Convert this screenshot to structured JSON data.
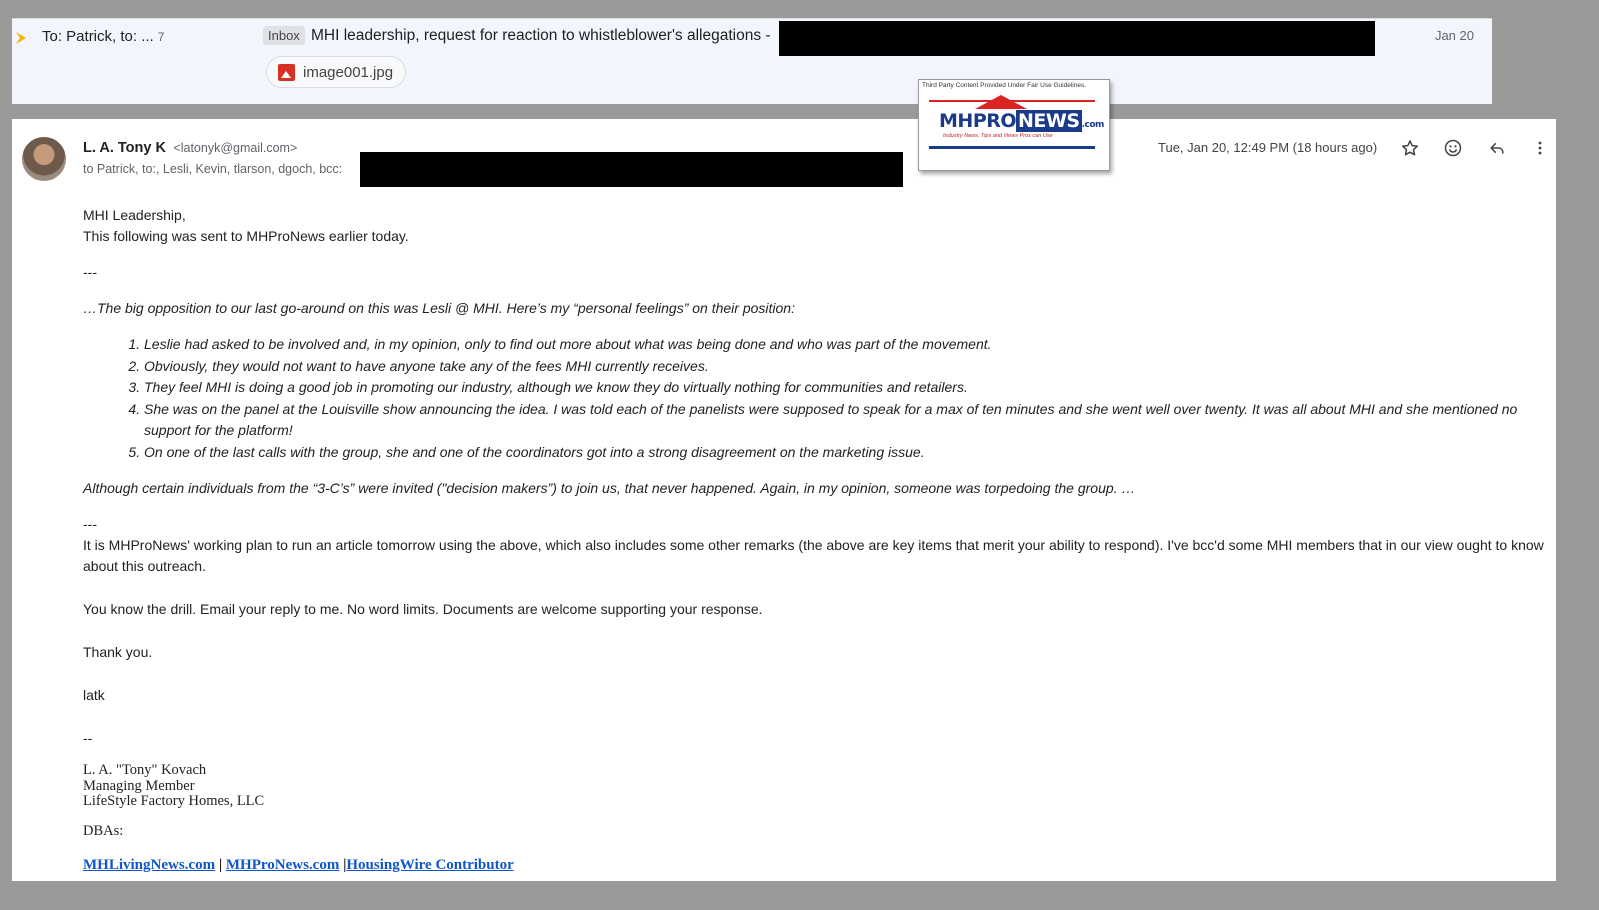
{
  "thread": {
    "recipients": "To: Patrick, to: ...",
    "count": "7",
    "label": "Inbox",
    "subject": "MHI leadership, request for reaction to whistleblower's allegations -",
    "date": "Jan 20",
    "attachment": "image001.jpg"
  },
  "message": {
    "sender_name": "L. A. Tony K",
    "sender_email": "<latonyk@gmail.com>",
    "to": "to Patrick, to:, Lesli, Kevin, tlarson, dgoch, bcc:",
    "date": "Tue, Jan 20, 12:49 PM (18 hours ago)"
  },
  "logo": {
    "caption": "Third Party Content Provided Under Fair Use Guidelines.",
    "mh": "MH",
    "pro": "PRO",
    "news": "NEWS",
    "com": ".com",
    "tagline": "Industry News, Tips and Views Pros can Use"
  },
  "body": {
    "greeting": "MHI Leadership,",
    "intro": "This following was sent to MHProNews earlier today.",
    "sep1": "---",
    "quote_intro": "…The big opposition to our last go-around on this was Lesli @ MHI.  Here’s my “personal feelings” on their position:",
    "items": [
      "Leslie had asked to be involved and, in my opinion, only to find out more about what was being done and who was part of the movement.",
      "Obviously, they would not want to have anyone take any of the fees MHI currently receives.",
      "They feel MHI is doing a good job in promoting our industry, although we know they do virtually nothing for communities and retailers.",
      "She was on the panel at the Louisville show announcing the idea.  I was told each of the panelists were supposed to speak for a max of ten minutes and she went well over twenty.  It was all about MHI and she mentioned no support for the platform!",
      "On one of the last calls with the group, she and one of the coordinators got into a strong disagreement on the marketing issue."
    ],
    "quote_outro": "Although certain individuals from the “3-C’s” were invited (\"decision makers”) to join us, that never happened.  Again, in my opinion, someone was torpedoing the group. …",
    "sep2": "---",
    "plan": "It is MHProNews' working plan to run an article tomorrow using the above, which also includes some other remarks (the above are key items that merit your ability to respond). I've bcc'd some MHI members that in our view ought to know about this outreach.",
    "drill": "You know the drill. Email your reply to me. No word limits. Documents are welcome supporting your response.",
    "thanks": "Thank you.",
    "initials": "latk",
    "sig_sep": "--",
    "sig_name": "L. A. \"Tony\" Kovach",
    "sig_title": "Managing Member",
    "sig_company": "LifeStyle Factory Homes, LLC",
    "dbas": "DBAs:",
    "links": [
      "MHLivingNews.com",
      "MHProNews.com",
      "HousingWire Contributor"
    ],
    "link_sep": "|"
  }
}
